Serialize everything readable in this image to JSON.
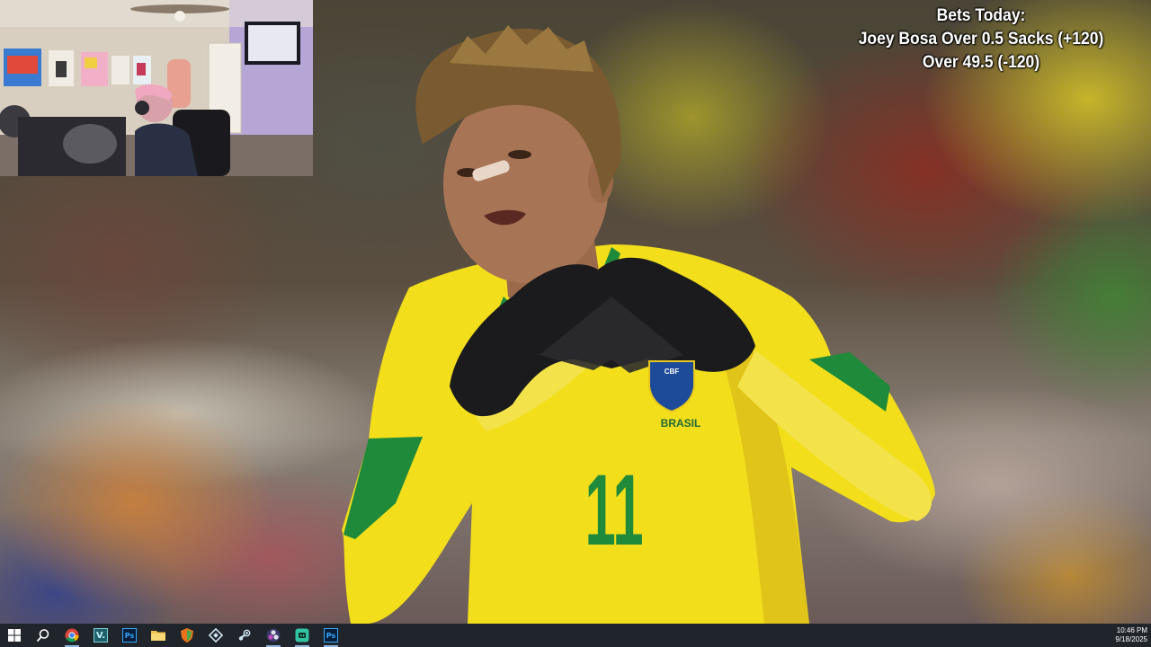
{
  "overlay": {
    "title": "Bets Today:",
    "bets": [
      "Joey Bosa Over 0.5 Sacks (+120)",
      "Over 49.5 (-120)"
    ]
  },
  "wallpaper": {
    "jersey_number": "11",
    "crest_text": "CBF",
    "jersey_text": "BRASIL"
  },
  "taskbar": {
    "apps": [
      {
        "name": "start",
        "icon": "windows-logo-icon"
      },
      {
        "name": "search",
        "icon": "search-icon"
      },
      {
        "name": "Google Chrome",
        "icon": "chrome-icon",
        "open": true
      },
      {
        "name": "Vegas",
        "icon": "vegas-icon",
        "label": "V."
      },
      {
        "name": "Photoshop",
        "icon": "photoshop-icon",
        "label": "Ps"
      },
      {
        "name": "File Explorer",
        "icon": "folder-icon"
      },
      {
        "name": "Shield app",
        "icon": "shield-icon"
      },
      {
        "name": "Kodi",
        "icon": "kodi-icon"
      },
      {
        "name": "Steam",
        "icon": "steam-icon"
      },
      {
        "name": "OBS",
        "icon": "obs-icon",
        "open": true
      },
      {
        "name": "Streamlabs",
        "icon": "streamlabs-icon",
        "open": true
      },
      {
        "name": "Photoshop 2",
        "icon": "photoshop-icon",
        "label": "Ps",
        "open": true
      }
    ],
    "clock": {
      "time": "10:46 PM",
      "date": "9/18/2025"
    }
  },
  "colors": {
    "taskbar_bg": "#20242b",
    "jersey_yellow": "#f2de1b",
    "jersey_green": "#1e8a3a",
    "bets_text": "#ffffff"
  }
}
